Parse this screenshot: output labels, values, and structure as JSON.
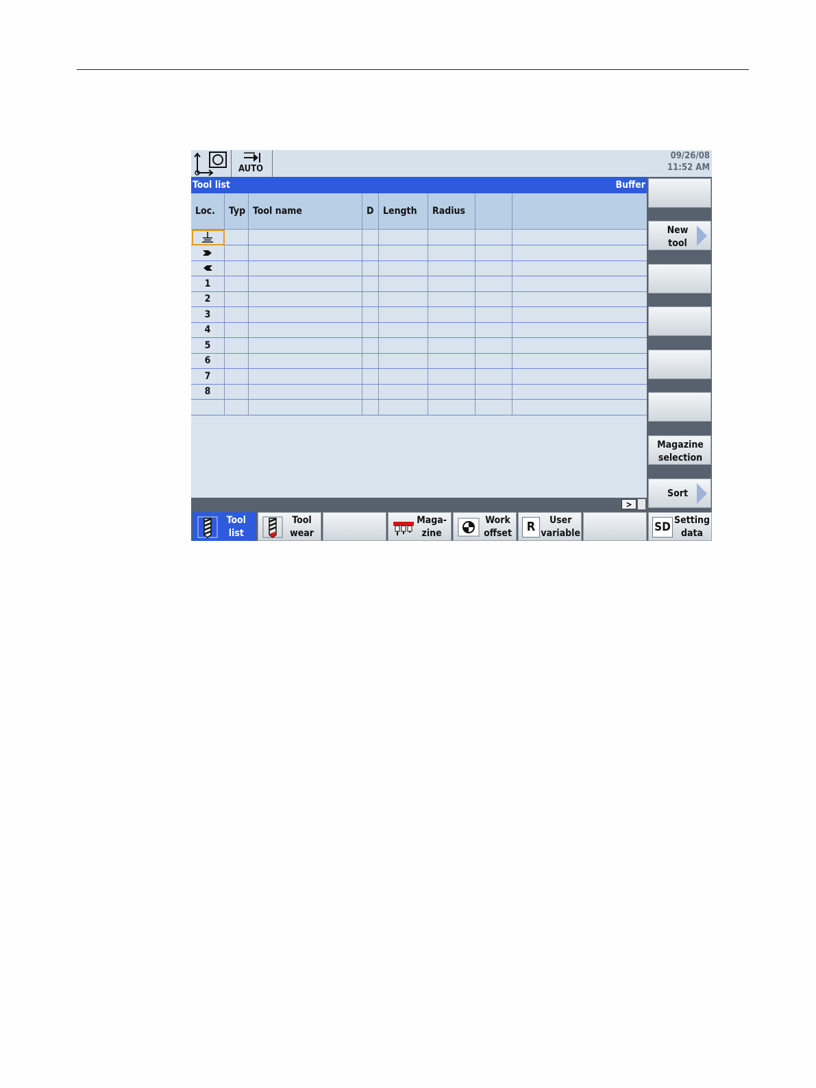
{
  "header": {
    "mode": "AUTO",
    "date": "09/26/08",
    "time": "11:52 AM",
    "icons": [
      "axes-spindle-icon",
      "auto-mode-icon"
    ]
  },
  "titlebar": {
    "left": "Tool list",
    "right": "Buffer"
  },
  "table": {
    "columns": [
      "Loc.",
      "Typ",
      "Tool name",
      "D",
      "Length",
      "Radius",
      "",
      ""
    ],
    "rows": [
      "spindle-icon",
      "gripper-right-icon",
      "gripper-left-icon",
      "1",
      "2",
      "3",
      "4",
      "5",
      "6",
      "7",
      "8",
      ""
    ]
  },
  "scroll": {
    "right_label": ">"
  },
  "vsoftkeys": [
    {
      "line1": "",
      "line2": ""
    },
    {
      "line1": "New",
      "line2": "tool",
      "arrow": true
    },
    {
      "line1": "",
      "line2": ""
    },
    {
      "line1": "",
      "line2": ""
    },
    {
      "line1": "",
      "line2": ""
    },
    {
      "line1": "",
      "line2": ""
    },
    {
      "line1": "Magazine",
      "line2": "selection"
    },
    {
      "line1": "Sort",
      "line2": "",
      "arrow": true
    }
  ],
  "hsoftkeys": [
    {
      "line1": "Tool",
      "line2": "list",
      "icon": "tool-list-icon",
      "active": true
    },
    {
      "line1": "Tool",
      "line2": "wear",
      "icon": "tool-wear-icon"
    },
    {
      "line1": "",
      "line2": ""
    },
    {
      "line1": "Maga-",
      "line2": "zine",
      "icon": "magazine-icon"
    },
    {
      "line1": "Work",
      "line2": "offset",
      "icon": "work-offset-icon"
    },
    {
      "line1": "User",
      "line2": "variable",
      "icon": "user-variable-icon",
      "icon_text": "R"
    },
    {
      "line1": "",
      "line2": ""
    },
    {
      "line1": "Setting",
      "line2": "data",
      "icon": "setting-data-icon",
      "icon_text": "SD"
    }
  ]
}
